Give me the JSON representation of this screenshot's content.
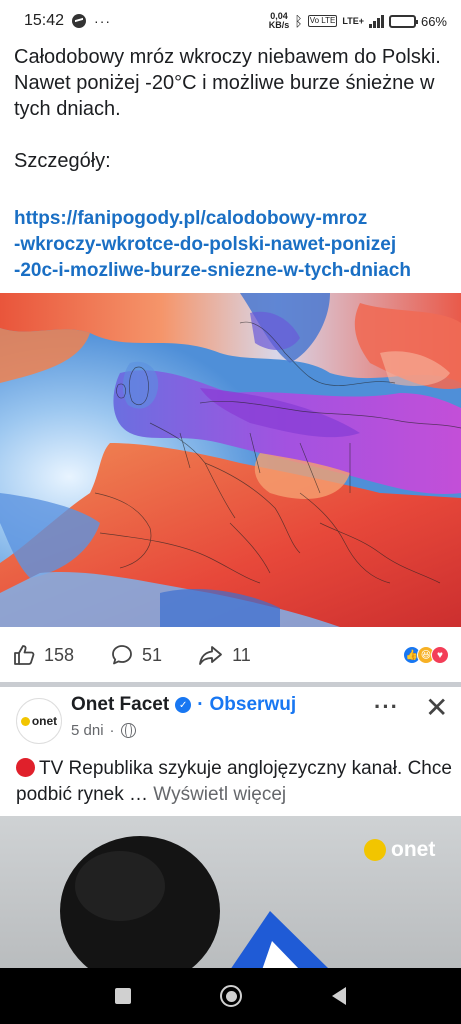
{
  "status_bar": {
    "time": "15:42",
    "net_speed_value": "0,04",
    "net_speed_unit": "KB/s",
    "volte": "Vo LTE",
    "lte": "LTE+",
    "battery_pct": "66%",
    "battery_level": 0.66,
    "overflow": "···"
  },
  "post": {
    "text_para1": "Całodobowy mróz wkroczy niebawem do Polski. Nawet poniżej -20°C i możliwe burze śnieżne w tych dniach.",
    "text_para2": "Szczegóły:",
    "link_lines": [
      "https://fanipogody.pl/calodobowy-mroz",
      "-wkroczy-wkrotce-do-polski-nawet-ponizej",
      "-20c-i-mozliwe-burze-sniezne-w-tych-dniach"
    ],
    "likes": "158",
    "comments": "51",
    "shares": "11"
  },
  "post2": {
    "page_name": "Onet Facet",
    "separator": "·",
    "follow_label": "Obserwuj",
    "time": "5 dni",
    "meta_sep": "·",
    "avatar_text": "onet",
    "text": "TV Republika szykuje anglojęzyczny kanał. Chce podbić rynek …",
    "see_more": "Wyświetl więcej",
    "image_logo": "onet"
  },
  "colors": {
    "link": "#1a6fc4",
    "facebook_blue": "#1877f2",
    "onet_yellow": "#f2c500"
  }
}
